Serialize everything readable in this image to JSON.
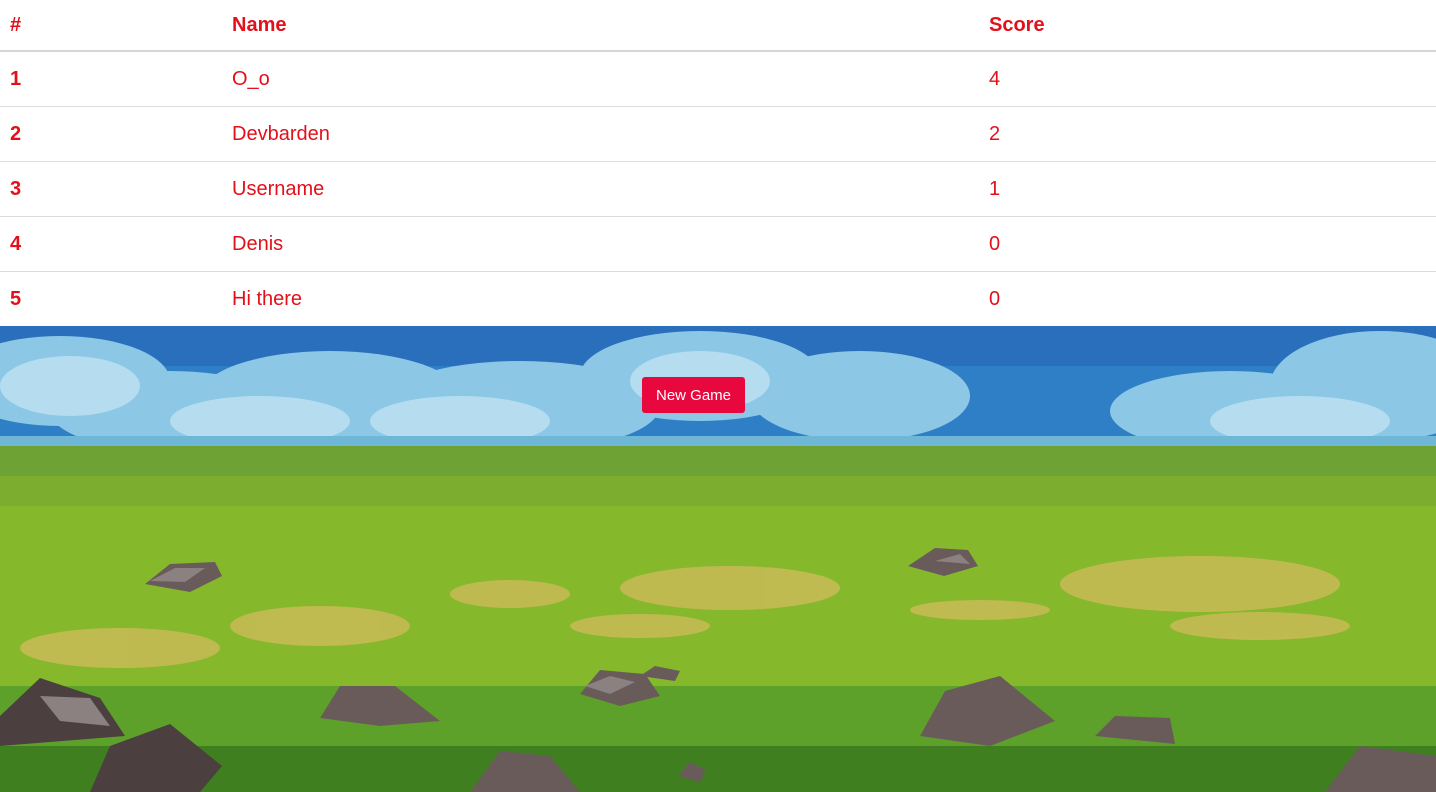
{
  "leaderboard": {
    "headers": {
      "rank": "#",
      "name": "Name",
      "score": "Score"
    },
    "rows": [
      {
        "rank": "1",
        "name": "O_o",
        "score": "4"
      },
      {
        "rank": "2",
        "name": "Devbarden",
        "score": "2"
      },
      {
        "rank": "3",
        "name": "Username",
        "score": "1"
      },
      {
        "rank": "4",
        "name": "Denis",
        "score": "0"
      },
      {
        "rank": "5",
        "name": "Hi there",
        "score": "0"
      }
    ]
  },
  "actions": {
    "new_game_label": "New Game"
  },
  "colors": {
    "text_accent": "#e3101a",
    "button_bg": "#e8083e",
    "button_text": "#ffffff"
  }
}
